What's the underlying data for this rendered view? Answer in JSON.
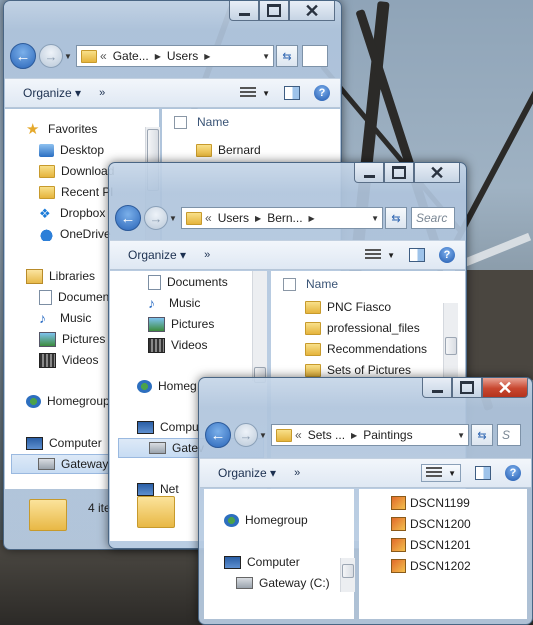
{
  "window1": {
    "address": {
      "chevron": "«",
      "segments": [
        "Gate...",
        "Users"
      ]
    },
    "toolbar": {
      "organize": "Organize",
      "more": "»"
    },
    "nav": [
      {
        "label": "Favorites",
        "icon": "star-icon"
      },
      {
        "label": "Desktop",
        "icon": "desktop-icon"
      },
      {
        "label": "Download",
        "icon": "downloads-icon"
      },
      {
        "label": "Recent Pl",
        "icon": "recent-places-icon"
      },
      {
        "label": "Dropbox",
        "icon": "dropbox-icon"
      },
      {
        "label": "OneDrive",
        "icon": "onedrive-icon"
      },
      {
        "label": "Libraries",
        "icon": "libraries-icon"
      },
      {
        "label": "Documen",
        "icon": "documents-icon"
      },
      {
        "label": "Music",
        "icon": "music-icon"
      },
      {
        "label": "Pictures",
        "icon": "pictures-icon"
      },
      {
        "label": "Videos",
        "icon": "videos-icon"
      },
      {
        "label": "Homegroup",
        "icon": "homegroup-icon"
      },
      {
        "label": "Computer",
        "icon": "computer-icon"
      },
      {
        "label": "Gateway (",
        "icon": "drive-icon"
      }
    ],
    "column_name": "Name",
    "files": [
      "Bernard"
    ],
    "status": "4 ite"
  },
  "window2": {
    "address": {
      "chevron": "«",
      "segments": [
        "Users",
        "Bern..."
      ]
    },
    "search_placeholder": "Searc",
    "toolbar": {
      "organize": "Organize",
      "more": "»"
    },
    "nav": [
      {
        "label": "Documents",
        "icon": "documents-icon"
      },
      {
        "label": "Music",
        "icon": "music-icon"
      },
      {
        "label": "Pictures",
        "icon": "pictures-icon"
      },
      {
        "label": "Videos",
        "icon": "videos-icon"
      },
      {
        "label": "Homeg",
        "icon": "homegroup-icon"
      },
      {
        "label": "Compu",
        "icon": "computer-icon"
      },
      {
        "label": "Gatev",
        "icon": "drive-icon"
      },
      {
        "label": "Net",
        "icon": "network-icon"
      }
    ],
    "column_name": "Name",
    "files": [
      "PNC Fiasco",
      "professional_files",
      "Recommendations",
      "Sets of Pictures"
    ]
  },
  "window3": {
    "address": {
      "chevron": "«",
      "segments": [
        "Sets ...",
        "Paintings"
      ]
    },
    "search_placeholder": "S",
    "toolbar": {
      "organize": "Organize",
      "more": "»"
    },
    "nav": [
      {
        "label": "Homegroup",
        "icon": "homegroup-icon"
      },
      {
        "label": "Computer",
        "icon": "computer-icon"
      },
      {
        "label": "Gateway (C:)",
        "icon": "drive-icon"
      }
    ],
    "files": [
      "DSCN1199",
      "DSCN1200",
      "DSCN1201",
      "DSCN1202"
    ]
  }
}
